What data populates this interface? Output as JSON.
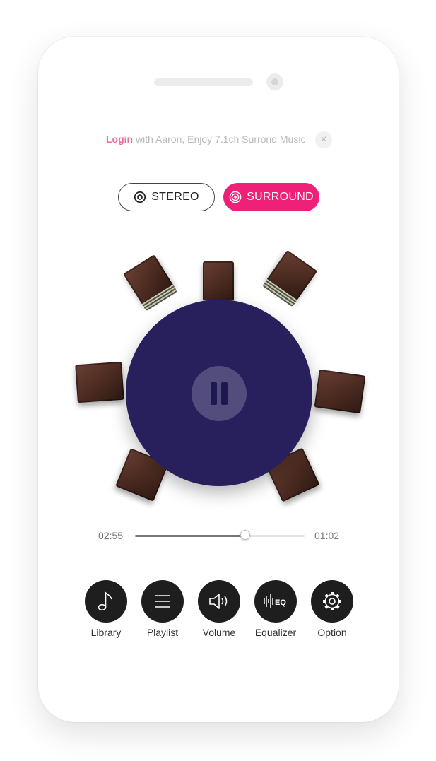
{
  "banner": {
    "login_link": "Login",
    "message": " with Aaron, Enjoy 7.1ch Surrond Music"
  },
  "modes": [
    {
      "label": "STEREO",
      "icon": "stereo-target-icon",
      "selected": false
    },
    {
      "label": "SURROUND",
      "icon": "surround-target-icon",
      "selected": true
    }
  ],
  "player": {
    "state_icon": "pause-icon",
    "speaker_count": 7,
    "elapsed": "02:55",
    "remaining": "01:02",
    "progress": 0.65
  },
  "nav": [
    {
      "label": "Library",
      "icon": "music-note-icon"
    },
    {
      "label": "Playlist",
      "icon": "list-icon"
    },
    {
      "label": "Volume",
      "icon": "speaker-volume-icon"
    },
    {
      "label": "Equalizer",
      "icon": "equalizer-icon"
    },
    {
      "label": "Option",
      "icon": "gear-icon"
    }
  ],
  "colors": {
    "accent": "#ee2077",
    "login": "#f2689b",
    "disc": "#27205d",
    "nav_button": "#1e1e1e"
  }
}
